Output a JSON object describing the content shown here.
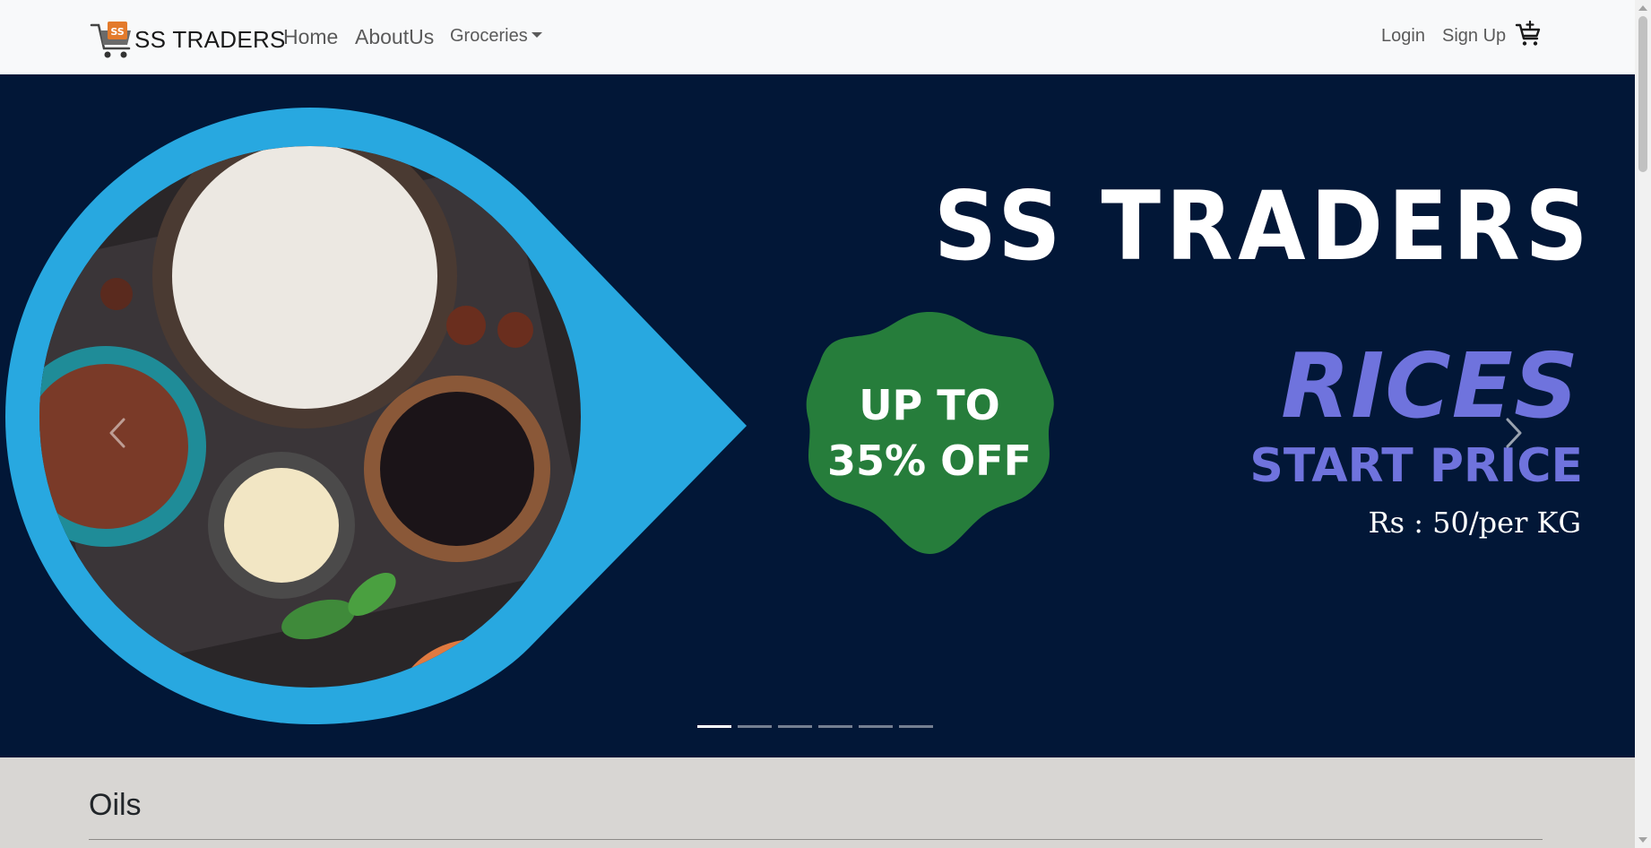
{
  "navbar": {
    "brand": "SS TRADERS",
    "logo_text": "SS",
    "links": {
      "home": "Home",
      "about": "AboutUs",
      "groceries": "Groceries"
    },
    "login": "Login",
    "signup": "Sign Up"
  },
  "carousel": {
    "brand_title": "SS TRADERS",
    "badge_line1": "UP TO",
    "badge_line2": "35% OFF",
    "product": "RICES",
    "start_price": "START PRICE",
    "price": "Rs : 50/per KG",
    "slide_count": 6,
    "active_slide": 1
  },
  "section": {
    "title": "Oils"
  },
  "colors": {
    "navbar_bg": "#f8f9fa",
    "banner_bg": "#021737",
    "drop_blue": "#28a8e0",
    "badge_green": "#267d3b",
    "accent_purple": "#6f73dd",
    "section_bg": "#d8d6d3"
  }
}
